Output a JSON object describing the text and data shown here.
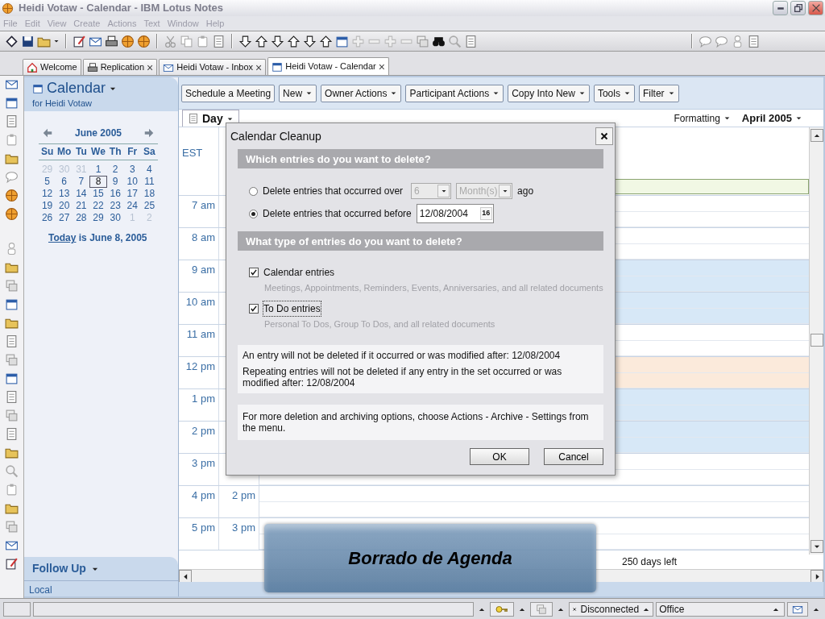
{
  "window": {
    "title": "Heidi Votaw - Calendar - IBM Lotus Notes"
  },
  "menu": [
    "File",
    "Edit",
    "View",
    "Create",
    "Actions",
    "Text",
    "Window",
    "Help"
  ],
  "tabs": [
    {
      "label": "Welcome",
      "selected": false
    },
    {
      "label": "Replication",
      "close": "×",
      "selected": false
    },
    {
      "label": "Heidi Votaw - Inbox",
      "close": "×",
      "selected": false
    },
    {
      "label": "Heidi Votaw - Calendar",
      "close": "×",
      "selected": true
    }
  ],
  "navigator": {
    "title": "Calendar",
    "subtitle": "for Heidi Votaw",
    "month": "June  2005",
    "weekdays": [
      "Su",
      "Mo",
      "Tu",
      "We",
      "Th",
      "Fr",
      "Sa"
    ],
    "days": [
      {
        "day": "29",
        "other_month": true,
        "selected": false
      },
      {
        "day": "30",
        "other_month": true,
        "selected": false
      },
      {
        "day": "31",
        "other_month": true,
        "selected": false
      },
      {
        "day": "1",
        "other_month": false,
        "selected": false
      },
      {
        "day": "2",
        "other_month": false,
        "selected": false
      },
      {
        "day": "3",
        "other_month": false,
        "selected": false
      },
      {
        "day": "4",
        "other_month": false,
        "selected": false
      },
      {
        "day": "5",
        "other_month": false,
        "selected": false
      },
      {
        "day": "6",
        "other_month": false,
        "selected": false
      },
      {
        "day": "7",
        "other_month": false,
        "selected": false
      },
      {
        "day": "8",
        "other_month": false,
        "selected": true
      },
      {
        "day": "9",
        "other_month": false,
        "selected": false
      },
      {
        "day": "10",
        "other_month": false,
        "selected": false
      },
      {
        "day": "11",
        "other_month": false,
        "selected": false
      },
      {
        "day": "12",
        "other_month": false,
        "selected": false
      },
      {
        "day": "13",
        "other_month": false,
        "selected": false
      },
      {
        "day": "14",
        "other_month": false,
        "selected": false
      },
      {
        "day": "15",
        "other_month": false,
        "selected": false
      },
      {
        "day": "16",
        "other_month": false,
        "selected": false
      },
      {
        "day": "17",
        "other_month": false,
        "selected": false
      },
      {
        "day": "18",
        "other_month": false,
        "selected": false
      },
      {
        "day": "19",
        "other_month": false,
        "selected": false
      },
      {
        "day": "20",
        "other_month": false,
        "selected": false
      },
      {
        "day": "21",
        "other_month": false,
        "selected": false
      },
      {
        "day": "22",
        "other_month": false,
        "selected": false
      },
      {
        "day": "23",
        "other_month": false,
        "selected": false
      },
      {
        "day": "24",
        "other_month": false,
        "selected": false
      },
      {
        "day": "25",
        "other_month": false,
        "selected": false
      },
      {
        "day": "26",
        "other_month": false,
        "selected": false
      },
      {
        "day": "27",
        "other_month": false,
        "selected": false
      },
      {
        "day": "28",
        "other_month": false,
        "selected": false
      },
      {
        "day": "29",
        "other_month": false,
        "selected": false
      },
      {
        "day": "30",
        "other_month": false,
        "selected": false
      },
      {
        "day": "1",
        "other_month": true,
        "selected": false
      },
      {
        "day": "2",
        "other_month": true,
        "selected": false
      }
    ],
    "today": "**Today** is June 8, 2005",
    "follow_up": "Follow Up",
    "footer": "Local"
  },
  "actions": [
    {
      "label": "Schedule a Meeting",
      "dropdown": false
    },
    {
      "label": "New",
      "dropdown": true
    },
    {
      "label": "Owner Actions",
      "dropdown": true
    },
    {
      "label": "Participant Actions",
      "dropdown": true
    },
    {
      "label": "Copy Into New",
      "dropdown": true
    },
    {
      "label": "Tools",
      "dropdown": true
    },
    {
      "label": "Filter",
      "dropdown": true
    }
  ],
  "view_tab": {
    "label": "Day"
  },
  "formatting": "Formatting",
  "period": "April 2005",
  "timeline": {
    "zone": "EST",
    "hours": [
      {
        "time": "7 am"
      },
      {
        "time": "8 am"
      },
      {
        "time": "9 am",
        "color": "#d7e8f7"
      },
      {
        "time": "10 am",
        "color": "#d7e8f7"
      },
      {
        "time": "11 am"
      },
      {
        "time": "12 pm",
        "color": "#fbeadb"
      },
      {
        "time": "1 pm",
        "color": "#d7e8f7"
      },
      {
        "time": "2 pm",
        "color": "#d7e8f7"
      },
      {
        "time": "3 pm"
      },
      {
        "time": "4 pm",
        "alt": "2 pm"
      },
      {
        "time": "5 pm",
        "alt": "3 pm"
      }
    ]
  },
  "days_left": "250 days left",
  "dialog": {
    "title": "Calendar Cleanup",
    "which_heading": "Which entries do you want to delete?",
    "options": [
      {
        "kind": "relative",
        "label": "Delete entries that occurred over",
        "selected": false,
        "amount": "6",
        "unit": "Month(s)",
        "suffix": "ago",
        "disabled": true
      },
      {
        "kind": "date",
        "label": "Delete entries that occurred before",
        "selected": true,
        "date": "12/08/2004",
        "picker": "16"
      }
    ],
    "type_heading": "What type of entries do you want to delete?",
    "types": [
      {
        "label": "Calendar entries",
        "checked": true,
        "focused": false,
        "description": "Meetings, Appointments, Reminders, Events, Anniversaries, and all related documents"
      },
      {
        "label": "To Do entries",
        "checked": true,
        "focused": true,
        "description": "Personal To Dos, Group To Dos, and all related documents"
      }
    ],
    "notes": [
      "An entry will not be deleted if it occurred or was modified after:  12/08/2004",
      "Repeating entries will not be deleted if any entry in the set occurred or was modified after:  12/08/2004"
    ],
    "hint": "For more deletion and archiving options, choose Actions - Archive - Settings from the menu.",
    "buttons": [
      "OK",
      "Cancel"
    ]
  },
  "caption": "Borrado de Agenda",
  "status_bar": {
    "connection": "Disconnected",
    "location": "Office"
  }
}
